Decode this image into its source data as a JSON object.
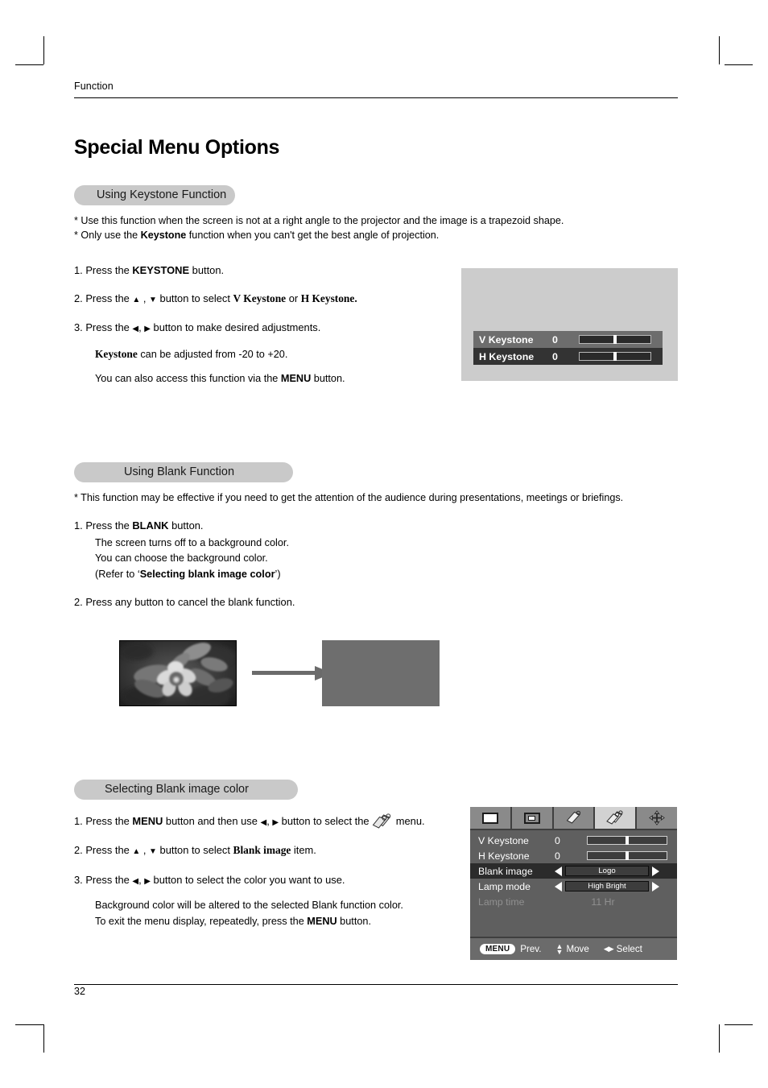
{
  "document": {
    "running_head": "Function",
    "page_title": "Special Menu Options",
    "page_number": "32"
  },
  "section_keystone": {
    "heading": "Using Keystone Function",
    "notes": [
      "* Use this function when the screen is not at a right angle to the projector and the image is a trapezoid shape.",
      "* Only use the Keystone function when you can't get the best angle of projection."
    ],
    "note1_a": "* Use this function when the screen is not at a right angle to the projector and the image is a trapezoid shape.",
    "note2_a": "* Only use the ",
    "note2_bold": "Keystone",
    "note2_b": " function when you can't get the best angle of projection.",
    "step1_a": "1. Press the ",
    "step1_bold": "KEYSTONE",
    "step1_b": " button.",
    "step2_a": "2. Press the ",
    "step2_glyph1": "▲",
    "step2_mid": " , ",
    "step2_glyph2": "▼",
    "step2_b": " button to select ",
    "step2_opt1": "V Keystone",
    "step2_or": " or ",
    "step2_opt2": "H Keystone.",
    "step3_a": "3. Press the ",
    "step3_glyph1": "◀",
    "step3_mid": ", ",
    "step3_glyph2": "▶",
    "step3_b": " button to make desired adjustments.",
    "sub1_bold": "Keystone",
    "sub1_rest": " can be adjusted from -20 to +20.",
    "sub2_a": "You can also access this function via the ",
    "sub2_bold": "MENU",
    "sub2_b": " button."
  },
  "keystone_osd": {
    "rows": [
      {
        "label": "V Keystone",
        "value": "0",
        "selected": true
      },
      {
        "label": "H Keystone",
        "value": "0",
        "selected": false
      }
    ]
  },
  "section_blank": {
    "heading": "Using Blank Function",
    "note_a": "* This function may be effective if you need to get the attention of the audience during presentations, meetings or briefings.",
    "step1_a": "1. Press the ",
    "step1_bold": "BLANK",
    "step1_b": " button.",
    "sub1": "The screen turns off to a background color.",
    "sub2": "You can choose the background color.",
    "sub3_a": "(Refer to ‘",
    "sub3_bold": "Selecting blank image color",
    "sub3_b": "’)",
    "step2": "2. Press any button to cancel the blank function.",
    "illustration": {
      "source_image_alt": "grayscale photo of a flower with leaves",
      "arrow_icon": "right-arrow-icon",
      "result_color": "#6e6e6e"
    }
  },
  "section_selecting": {
    "heading": "Selecting Blank image color",
    "step1_a": "1. Press the ",
    "step1_bold": "MENU",
    "step1_b": " button and then use  ",
    "step1_glyph1": "◀",
    "step1_mid": ", ",
    "step1_glyph2": "▶",
    "step1_c": " button to select the ",
    "step1_icon": "special-menu-tag-icon",
    "step1_d": " menu.",
    "step2_a": "2. Press the ",
    "step2_glyph1": "▲",
    "step2_mid": " , ",
    "step2_glyph2": "▼",
    "step2_b": " button to select ",
    "step2_item": "Blank image",
    "step2_c": " item.",
    "step3_a": "3. Press the  ",
    "step3_glyph1": "◀",
    "step3_mid": ", ",
    "step3_glyph2": "▶",
    "step3_b": " button to select the color you want to use.",
    "sub1": "Background color will be altered to the selected Blank function color.",
    "sub2_a": "To exit the menu display, repeatedly, press the ",
    "sub2_bold": "MENU",
    "sub2_b": " button."
  },
  "menu_osd": {
    "tabs": [
      {
        "icon": "picture-tab-icon",
        "active": false
      },
      {
        "icon": "screen-tab-icon",
        "active": false
      },
      {
        "icon": "single-tag-tab-icon",
        "active": false
      },
      {
        "icon": "special-tag-tab-icon",
        "active": true
      },
      {
        "icon": "signal-cross-tab-icon",
        "active": false
      }
    ],
    "rows": [
      {
        "label": "V Keystone",
        "value": "0",
        "type": "slider",
        "highlighted": false,
        "dimmed": false
      },
      {
        "label": "H Keystone",
        "value": "0",
        "type": "slider",
        "highlighted": false,
        "dimmed": false
      },
      {
        "label": "Blank image",
        "value": "Logo",
        "type": "option",
        "highlighted": true,
        "dimmed": false
      },
      {
        "label": "Lamp mode",
        "value": "High Bright",
        "type": "option",
        "highlighted": false,
        "dimmed": false
      },
      {
        "label": "Lamp time",
        "value": "11 Hr",
        "type": "readonly",
        "highlighted": false,
        "dimmed": true
      }
    ],
    "footer": {
      "menu_key": "MENU",
      "prev_label": "Prev.",
      "move_label": "Move",
      "select_label": "Select"
    }
  },
  "colors": {
    "pill_gray": "#c9c9c9",
    "osd_backdrop": "#cccccc",
    "osd_selected_row": "#6d6d6d",
    "osd_unselected_row": "#333333",
    "menu_body": "#5f5f5f",
    "menu_tabs": "#8a8a8a",
    "menu_tab_active": "#d2d2d2",
    "menu_highlight_row": "#2b2b2b"
  }
}
